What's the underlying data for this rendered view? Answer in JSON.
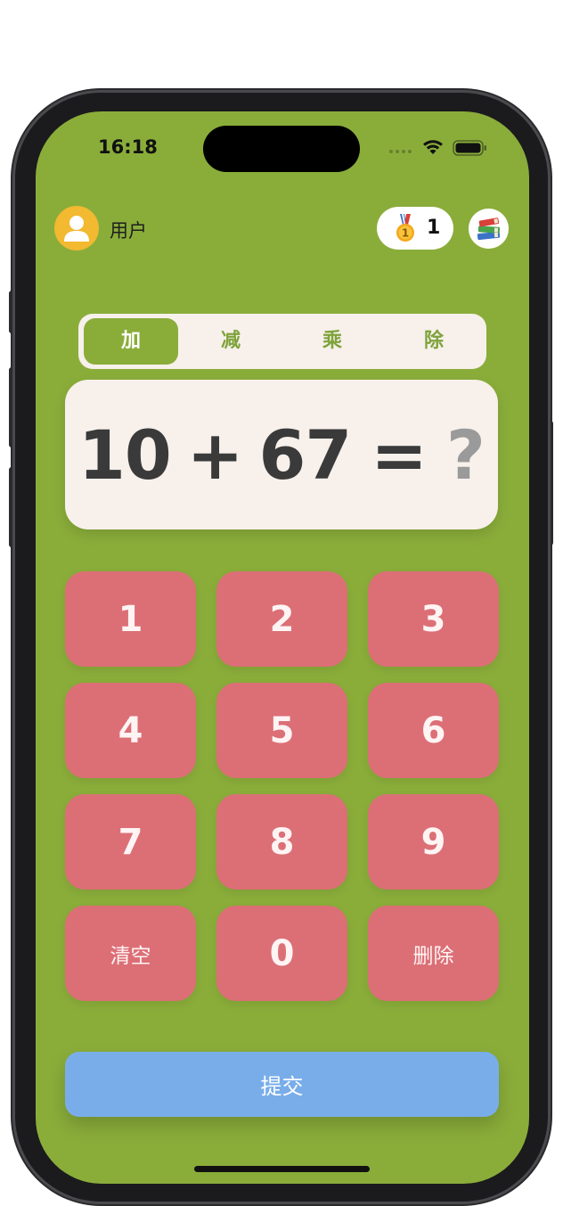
{
  "status_bar": {
    "time": "16:18"
  },
  "header": {
    "username": "用户",
    "medal_count": "1",
    "icons": [
      "user-avatar-icon",
      "medal-icon",
      "books-icon"
    ]
  },
  "operations": {
    "items": [
      {
        "label": "加",
        "active": true
      },
      {
        "label": "减",
        "active": false
      },
      {
        "label": "乘",
        "active": false
      },
      {
        "label": "除",
        "active": false
      }
    ]
  },
  "question": {
    "operand1": "10",
    "operator": "+",
    "operand2": "67",
    "equals": "=",
    "answer_placeholder": "?"
  },
  "keypad": {
    "keys": [
      "1",
      "2",
      "3",
      "4",
      "5",
      "6",
      "7",
      "8",
      "9",
      "清空",
      "0",
      "删除"
    ]
  },
  "submit": {
    "label": "提交"
  },
  "colors": {
    "background": "#8aad3a",
    "key": "#dc6f76",
    "card": "#f7f0eb",
    "submit": "#79adea",
    "avatar": "#f2b931"
  }
}
